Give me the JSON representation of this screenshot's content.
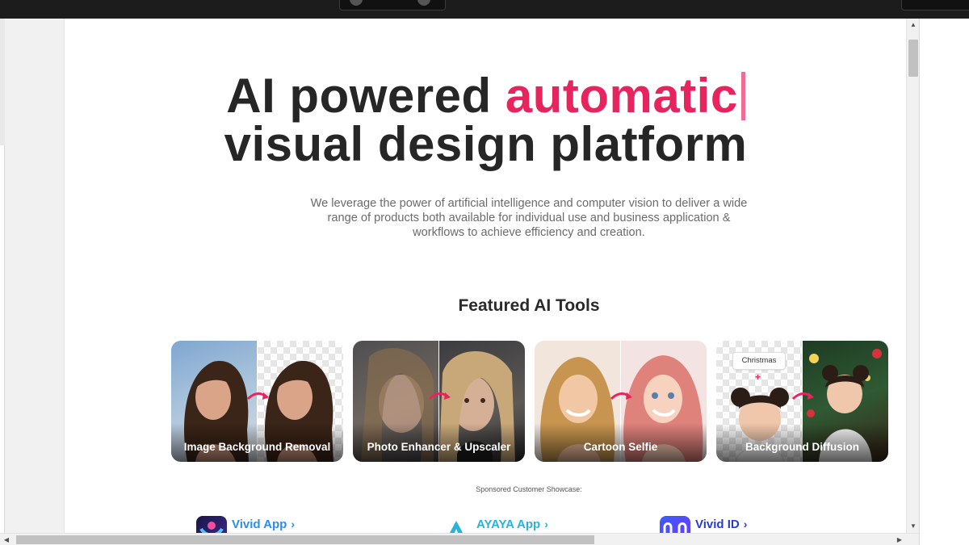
{
  "hero": {
    "title_line1_prefix": "AI powered ",
    "title_highlight": "automatic",
    "title_line2": "visual design platform",
    "description": "We leverage the power of artificial intelligence and computer vision to deliver a wide range of products both available for individual use and business application & workflows to achieve efficiency and creation."
  },
  "featured": {
    "heading": "Featured AI Tools",
    "tools": [
      {
        "label": "Image Background Removal"
      },
      {
        "label": "Photo Enhancer & Upscaler"
      },
      {
        "label": "Cartoon Selfie"
      },
      {
        "label": "Background Diffusion",
        "tag": "Christmas",
        "plus": "+"
      }
    ]
  },
  "sponsored": {
    "caption": "Sponsored Customer Showcase:",
    "apps": [
      {
        "name": "Vivid App",
        "chevron": "›",
        "color": "#2d8cf0"
      },
      {
        "name": "AYAYA App",
        "chevron": "›",
        "color": "#2ab2d8"
      },
      {
        "name": "Vivid ID",
        "chevron": "›",
        "color": "#2a3bd0"
      }
    ]
  },
  "colors": {
    "accent": "#e8245e",
    "title": "#262626"
  },
  "scrollbars": {
    "up_arrow": "▲",
    "down_arrow": "▼",
    "left_arrow": "◀",
    "right_arrow": "▶"
  }
}
